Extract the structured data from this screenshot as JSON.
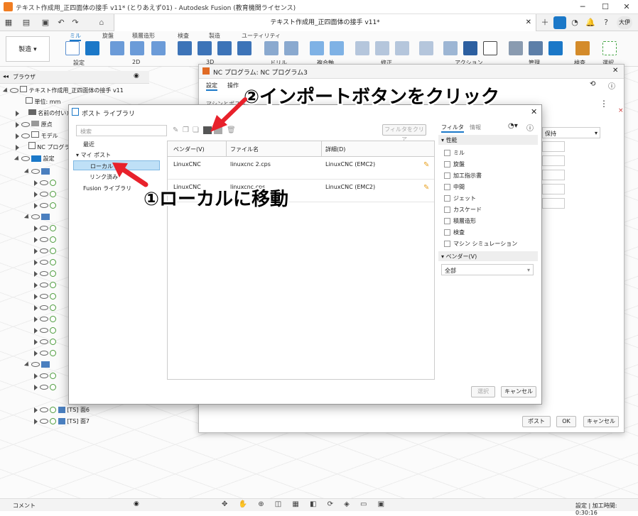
{
  "window": {
    "title": "テキスト作成用_正四面体の接手 v11* (とりあえず01) - Autodesk Fusion (教育機関ライセンス)"
  },
  "doc_tab": {
    "label": "テキスト作成用_正四面体の接手 v11*"
  },
  "user": {
    "initials": "大伊"
  },
  "ribbon": {
    "workspace": "製造",
    "tabs": [
      "ミル",
      "旋盤",
      "積層造形",
      "検査",
      "製造",
      "ユーティリティ"
    ],
    "groups": [
      "設定",
      "2D",
      "3D",
      "ドリル",
      "複合軸",
      "修正",
      "アクション",
      "管理",
      "検査",
      "選択"
    ]
  },
  "browser": {
    "header": "ブラウザ",
    "tree": [
      {
        "label": "テキスト作成用_正四面体の接手 v11",
        "indent": 0
      },
      {
        "label": "単位: mm",
        "indent": 1
      },
      {
        "label": "名前の付いたビュー",
        "indent": 1
      },
      {
        "label": "原点",
        "indent": 1
      },
      {
        "label": "モデル",
        "indent": 1
      },
      {
        "label": "NC プログラム",
        "indent": 1
      },
      {
        "label": "設定",
        "indent": 1
      }
    ],
    "ops": [
      "[TS] 面6",
      "[TS] 面7"
    ]
  },
  "nc_dialog": {
    "title": "NC プログラム: NC プログラム3",
    "tabs": [
      "設定",
      "操作"
    ],
    "field_label": "マシンとポスト",
    "dropdown_value": "保持",
    "buttons": {
      "post": "ポスト",
      "ok": "OK",
      "cancel": "キャンセル"
    }
  },
  "post_library": {
    "title": "ポスト ライブラリ",
    "search_placeholder": "検索",
    "nav": {
      "recent": "最近",
      "my_posts": "マイ ポスト",
      "local": "ローカル",
      "linked": "リンク済み",
      "fusion_library": "Fusion ライブラリ"
    },
    "clear_filter": "フィルタをクリア",
    "columns": [
      "ベンダー(V)",
      "ファイル名",
      "詳細(D)"
    ],
    "rows": [
      {
        "vendor": "LinuxCNC",
        "file": "linuxcnc 2.cps",
        "detail": "LinuxCNC (EMC2)"
      },
      {
        "vendor": "LinuxCNC",
        "file": "linuxcnc.cps",
        "detail": "LinuxCNC (EMC2)"
      }
    ],
    "filter_tabs": [
      "フィルタ",
      "情報"
    ],
    "capability_header": "性能",
    "capabilities": [
      "ミル",
      "旋盤",
      "加工指示書",
      "中間",
      "ジェット",
      "カスケード",
      "積層造形",
      "検査",
      "マシン シミュレーション"
    ],
    "vendor_header": "ベンダー(V)",
    "vendor_value": "全部",
    "select_btn": "選択",
    "cancel_btn": "キャンセル"
  },
  "annotations": {
    "step1": "①ローカルに移動",
    "step2": "②インポートボタンをクリック"
  },
  "status": {
    "comment": "コメント",
    "right": "設定 | 加工時間: 0:30:16"
  },
  "colors": {
    "accent": "#1b78c8",
    "arrow": "#e8212b",
    "selected": "#bfe0f7"
  }
}
